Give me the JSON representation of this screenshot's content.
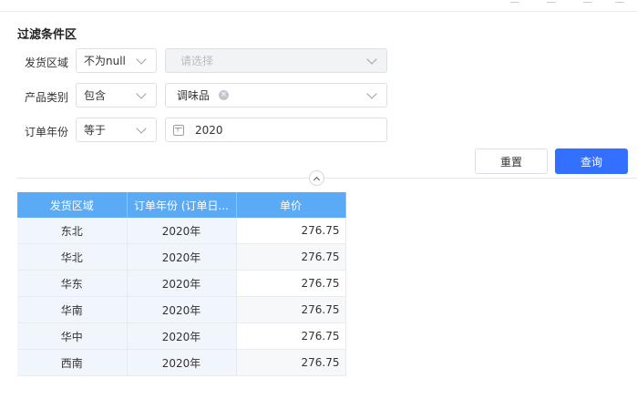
{
  "filter": {
    "title": "过滤条件区",
    "rows": [
      {
        "label": "发货区域",
        "operator": "不为null",
        "value": "",
        "placeholder": "请选择"
      },
      {
        "label": "产品类别",
        "operator": "包含",
        "value": "调味品"
      },
      {
        "label": "订单年份",
        "operator": "等于",
        "value": "2020"
      }
    ],
    "reset_label": "重置",
    "query_label": "查询"
  },
  "table": {
    "header_color": "#5aaaf5",
    "columns": [
      "发货区域",
      "订单年份 (订单日...",
      "单价"
    ],
    "rows": [
      [
        "东北",
        "2020年",
        "276.75"
      ],
      [
        "华北",
        "2020年",
        "276.75"
      ],
      [
        "华东",
        "2020年",
        "276.75"
      ],
      [
        "华南",
        "2020年",
        "276.75"
      ],
      [
        "华中",
        "2020年",
        "276.75"
      ],
      [
        "西南",
        "2020年",
        "276.75"
      ]
    ]
  },
  "accent_color": "#3370ff"
}
